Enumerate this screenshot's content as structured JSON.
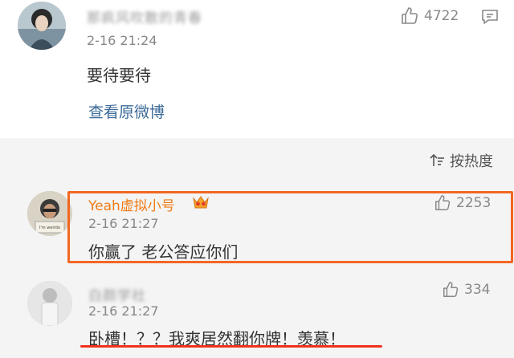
{
  "comment_top": {
    "username": "那疯风吹散的青春",
    "time": "2-16 21:24",
    "likes": "4722",
    "text": "要待要待",
    "view_original": "查看原微博"
  },
  "sort": {
    "label": "按热度"
  },
  "comments": [
    {
      "username": "Yeah虚拟小号",
      "time": "2-16 21:27",
      "likes": "2253",
      "text": "你赢了 老公答应你们"
    },
    {
      "username": "白颜学社",
      "time": "2-16 21:27",
      "likes": "334",
      "text": "卧槽！？？我爽居然翻你牌！羡慕！"
    }
  ],
  "colors": {
    "link_blue": "#3a6a98",
    "highlight_orange": "#f26722",
    "underline_red": "#f2321d",
    "username_orange": "#f07c16"
  }
}
